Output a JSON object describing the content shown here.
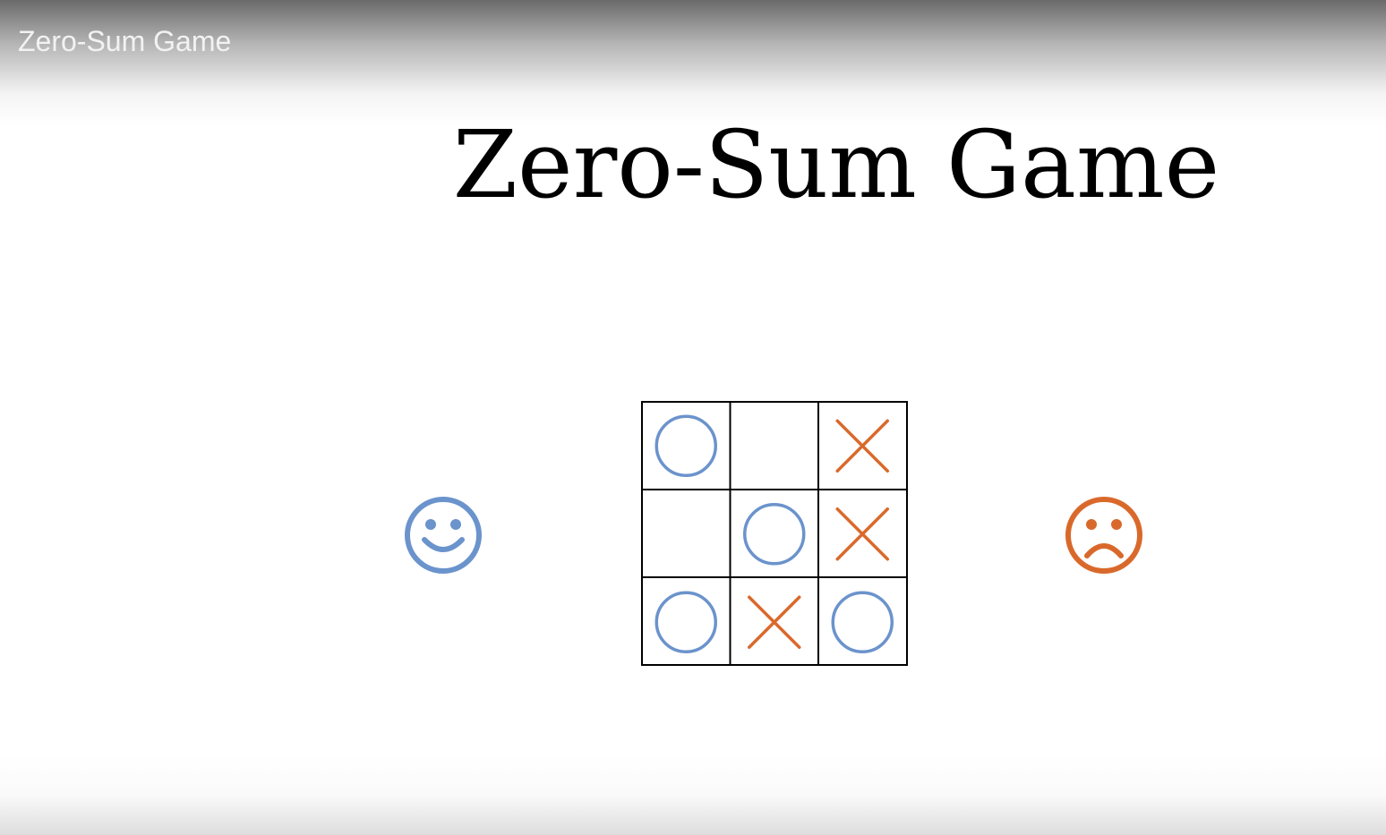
{
  "video": {
    "title": "Zero-Sum Game"
  },
  "slide": {
    "title": "Zero-Sum Game"
  },
  "board": {
    "cells": [
      [
        "O",
        "",
        "X"
      ],
      [
        "",
        "O",
        "X"
      ],
      [
        "O",
        "X",
        "O"
      ]
    ]
  },
  "players": {
    "winner": {
      "icon": "smiley-face-icon",
      "color": "#6b93cc"
    },
    "loser": {
      "icon": "frowning-face-icon",
      "color": "#d9692b"
    }
  },
  "colors": {
    "o_mark": "#6b93cc",
    "x_mark": "#d9692b",
    "grid": "#000000"
  }
}
